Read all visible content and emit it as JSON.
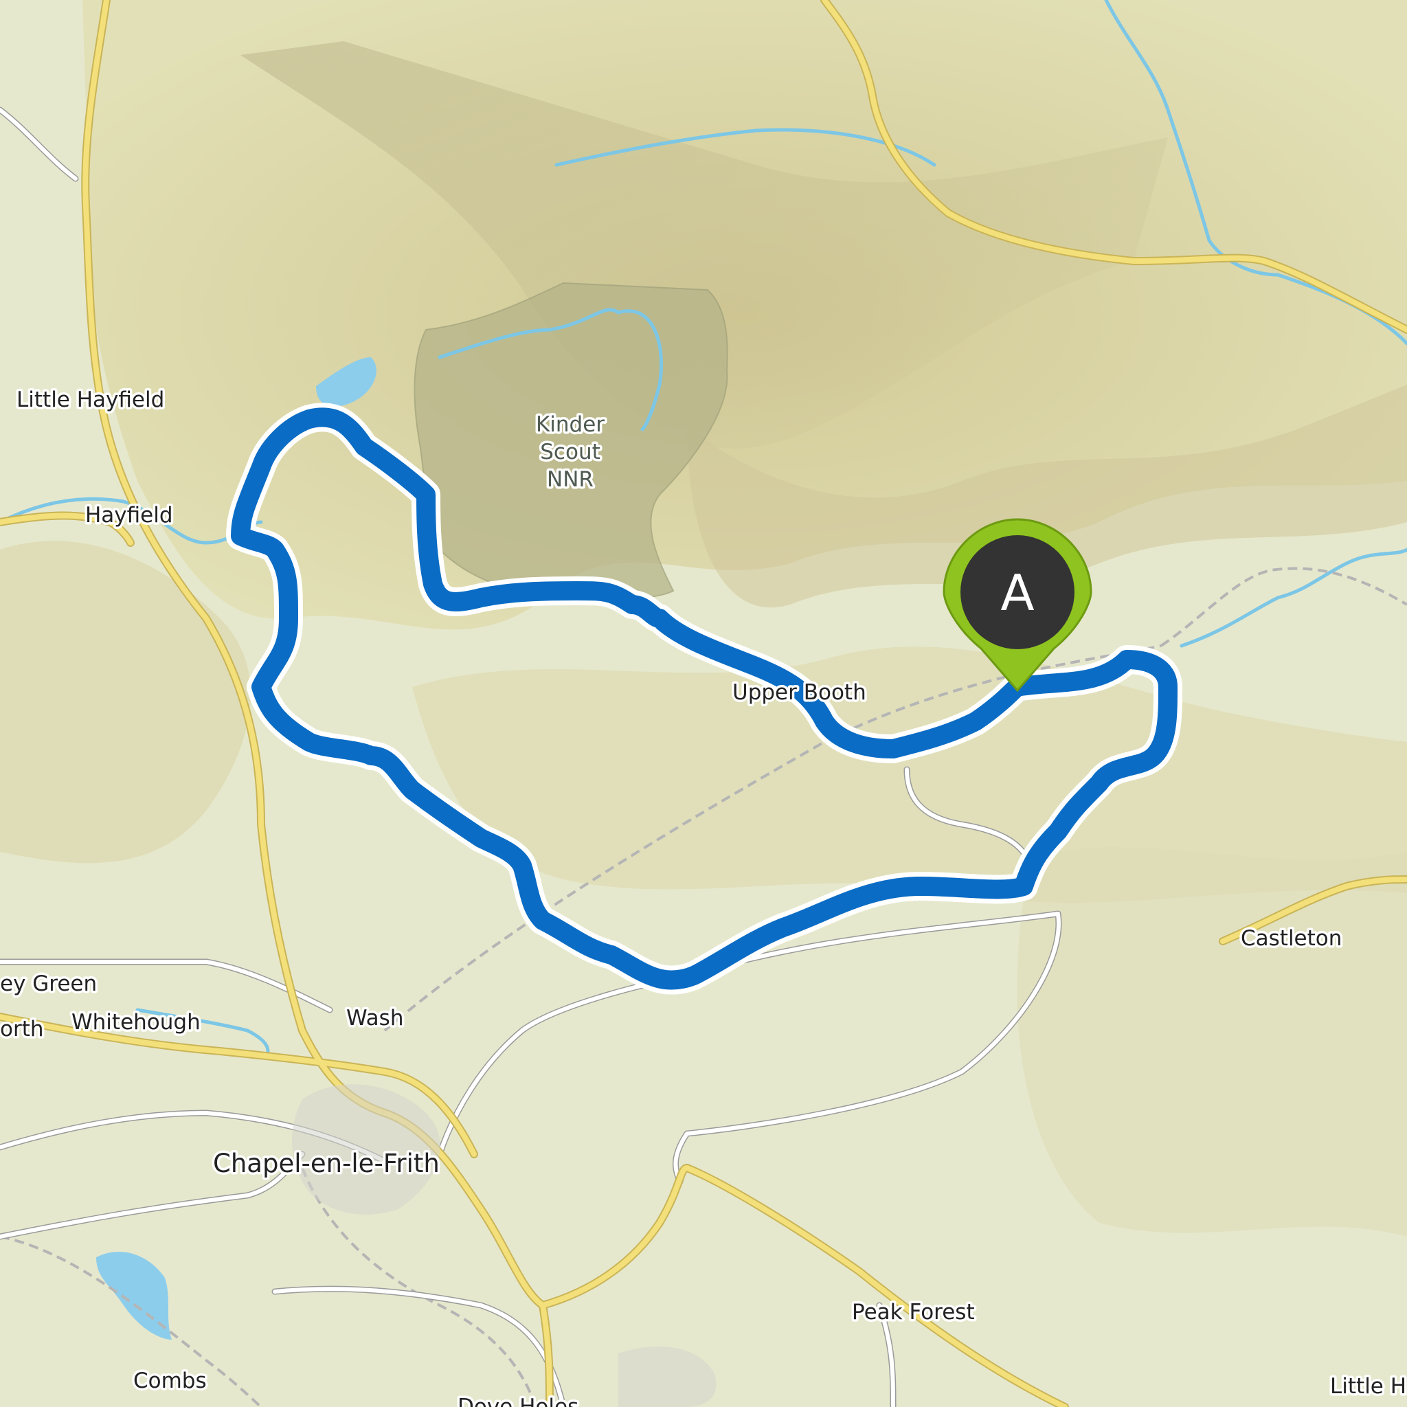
{
  "map": {
    "places": {
      "little_hayfield": "Little Hayfield",
      "hayfield": "Hayfield",
      "kinder_1": "Kinder",
      "kinder_2": "Scout",
      "kinder_3": "NNR",
      "upper_booth": "Upper Booth",
      "castleton": "Castleton",
      "chinley_green": "ey Green",
      "chinley": "orth",
      "whitehough": "Whitehough",
      "wash": "Wash",
      "chapel": "Chapel-en-le-Frith",
      "peak_forest": "Peak Forest",
      "combs": "Combs",
      "dove_holes": "Dove Holes",
      "little_hucklow": "Little H"
    },
    "marker": {
      "label": "A",
      "color": "#8fc31f",
      "badge_color": "#333333"
    },
    "route": {
      "color": "#0a6cc5",
      "casing_color": "#ffffff"
    },
    "colors": {
      "terrain": "#e9ecd2",
      "hills": "#d9d6a8",
      "water": "#7cc6e6",
      "major_road": "#f3e07a",
      "minor_road": "#ffffff",
      "nnr": "#b7b78a"
    }
  }
}
